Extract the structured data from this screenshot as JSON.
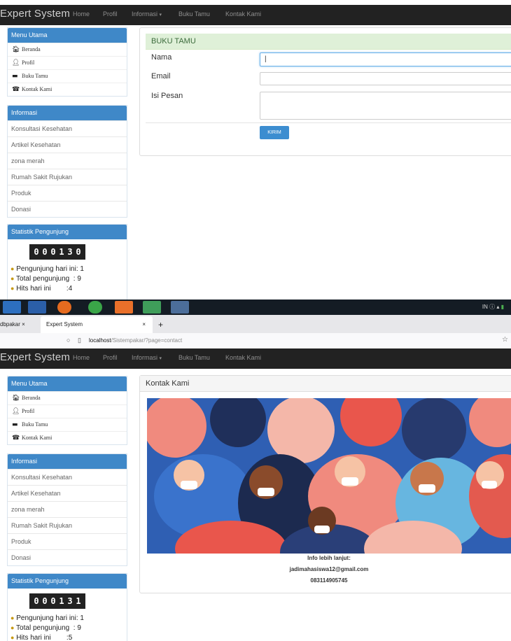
{
  "navbar": {
    "brand": "Expert System",
    "items": [
      "Home",
      "Profil",
      "Informasi",
      "Buku Tamu",
      "Kontak Kami"
    ]
  },
  "menu_utama": {
    "title": "Menu Utama",
    "items": [
      {
        "label": "Beranda",
        "icon": "home-icon"
      },
      {
        "label": "Profil",
        "icon": "user-icon"
      },
      {
        "label": "Buku  Tamu",
        "icon": "book-icon"
      },
      {
        "label": "Kontak  Kami",
        "icon": "contact-icon"
      }
    ]
  },
  "informasi": {
    "title": "Informasi",
    "items": [
      "Konsultasi Kesehatan",
      "Artikel Kesehatan",
      "zona merah",
      "Rumah Sakit Rujukan",
      "Produk",
      "Donasi"
    ]
  },
  "statistik_1": {
    "title": "Statistik Pengunjung",
    "digits": [
      "0",
      "0",
      "0",
      "1",
      "3",
      "0"
    ],
    "rows": [
      {
        "label": "Pengunjung hari ini",
        "sep": ":",
        "value": "1"
      },
      {
        "label": "Total pengunjung",
        "sep": ":",
        "value": "9"
      },
      {
        "label": "Hits hari ini",
        "sep": ":",
        "value": "4"
      }
    ]
  },
  "statistik_2": {
    "title": "Statistik Pengunjung",
    "digits": [
      "0",
      "0",
      "0",
      "1",
      "3",
      "1"
    ],
    "rows": [
      {
        "label": "Pengunjung hari ini",
        "sep": ":",
        "value": "1"
      },
      {
        "label": "Total pengunjung",
        "sep": ":",
        "value": "9"
      },
      {
        "label": "Hits hari ini",
        "sep": ":",
        "value": "5"
      }
    ]
  },
  "buku_tamu": {
    "title": "BUKU TAMU",
    "nama_label": "Nama",
    "nama_value": "|",
    "email_label": "Email",
    "pesan_label": "Isi Pesan",
    "submit": "KIRIM"
  },
  "browser": {
    "tab_prev": "dbpakar",
    "tab_close": "×",
    "tab_active": "Expert System",
    "new_tab": "+",
    "url_host": "localhost",
    "url_path": "/Sistempakar/?page=contact",
    "tray": "IN"
  },
  "kontak": {
    "title": "Kontak Kami",
    "info_title": "Info lebih lanjut:",
    "email": "jadimahasiswa12@gmail.com",
    "phone": "083114905745"
  },
  "colors": {
    "navbar": "#222222",
    "panel_header": "#3f88c8",
    "form_header": "#dff0d8",
    "button": "#3c8dd0"
  }
}
